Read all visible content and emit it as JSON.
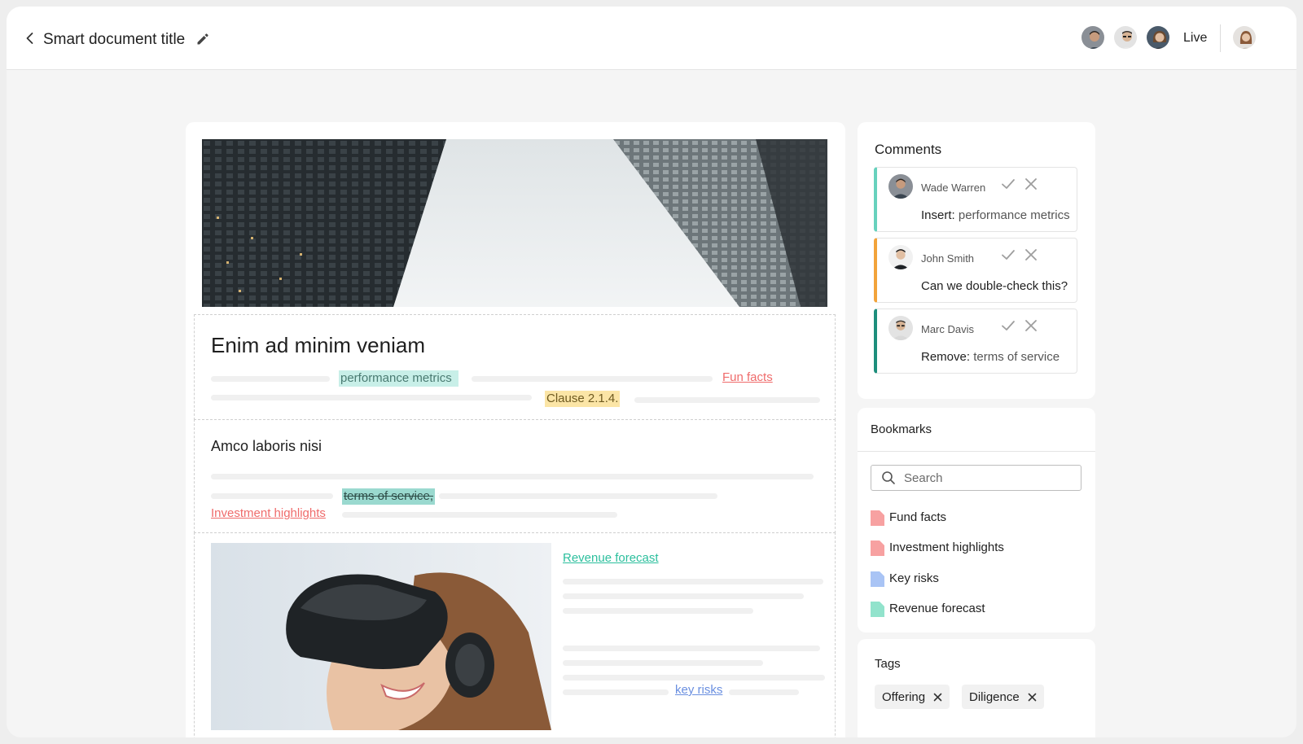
{
  "header": {
    "back_label": "Back",
    "title": "Smart document title",
    "live_label": "Live"
  },
  "document": {
    "section1": {
      "heading": "Enim ad minim veniam",
      "highlight_insert": "performance metrics",
      "link_fun_facts": "Fun facts",
      "highlight_clause": "Clause 2.1.4."
    },
    "section2": {
      "heading": "Amco laboris nisi",
      "highlight_removed": "terms of service,",
      "link_investment": "Investment highlights"
    },
    "section3": {
      "link_revenue": "Revenue forecast",
      "link_key_risks": "key risks"
    }
  },
  "comments": {
    "title": "Comments",
    "items": [
      {
        "author": "Wade Warren",
        "label": "Insert:",
        "value": "performance metrics",
        "accent": "#67d1bd"
      },
      {
        "author": "John Smith",
        "label": "",
        "value": "Can we double-check this?",
        "accent": "#f2a33a"
      },
      {
        "author": "Marc Davis",
        "label": "Remove:",
        "value": "terms of service",
        "accent": "#1d8e7c"
      }
    ]
  },
  "bookmarks": {
    "title": "Bookmarks",
    "search_placeholder": "Search",
    "items": [
      {
        "label": "Fund facts",
        "color": "#f7a1a1"
      },
      {
        "label": "Investment highlights",
        "color": "#f7a1a1"
      },
      {
        "label": "Key risks",
        "color": "#a9c4f5"
      },
      {
        "label": "Revenue forecast",
        "color": "#92e3cc"
      }
    ]
  },
  "tags": {
    "title": "Tags",
    "items": [
      "Offering",
      "Diligence"
    ]
  }
}
